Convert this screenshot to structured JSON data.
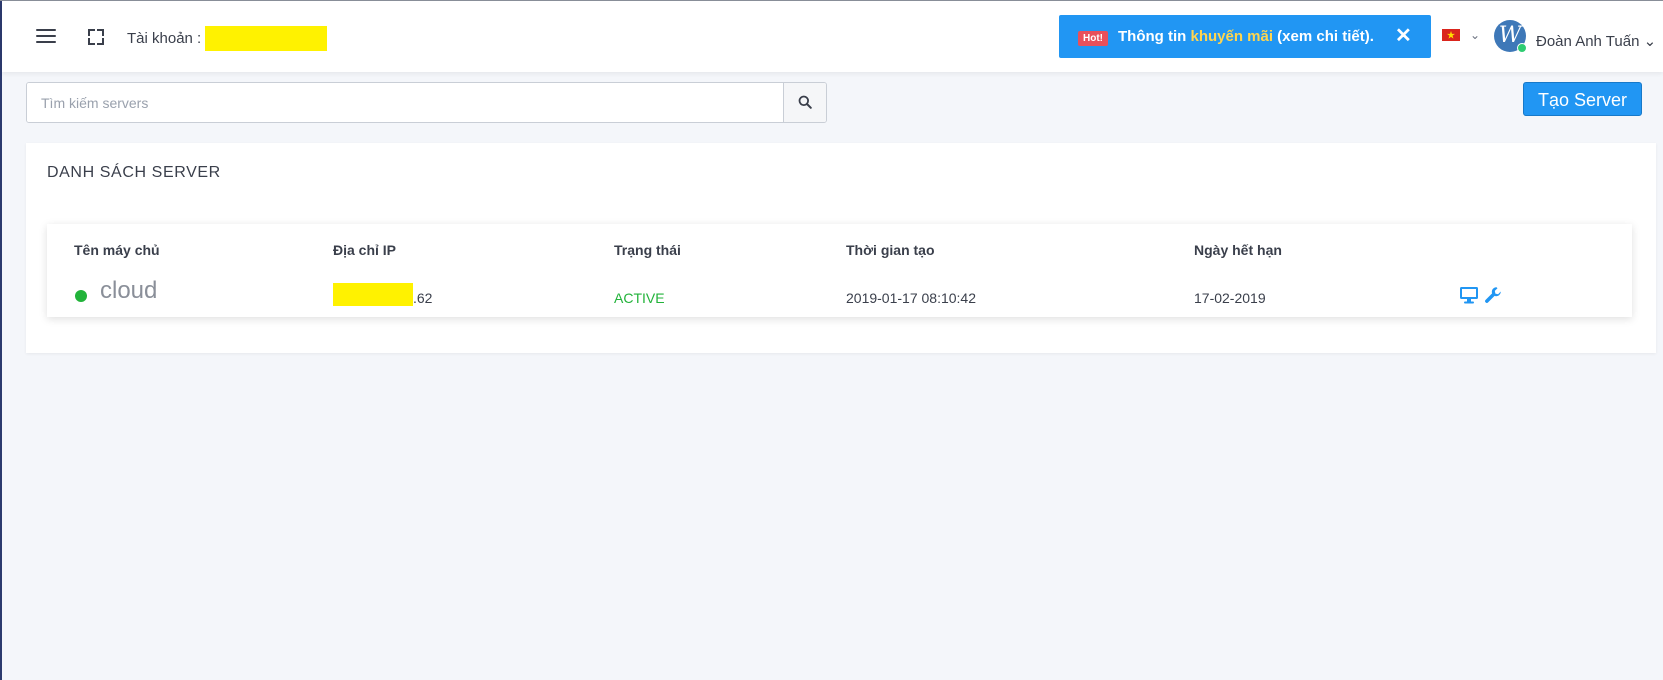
{
  "header": {
    "account_label": "Tài khoản :",
    "promo": {
      "badge": "Hot!",
      "text_before": "Thông tin ",
      "text_highlight": "khuyến mãi",
      "text_after": " (xem chi tiết).",
      "close": "✕"
    },
    "language_caret": "⌄",
    "avatar_letter": "W",
    "user_name": "Đoàn Anh Tuấn ⌄"
  },
  "search": {
    "placeholder": "Tìm kiếm servers"
  },
  "create_button": "Tạo Server",
  "server_list": {
    "title": "DANH SÁCH SERVER",
    "columns": [
      "Tên máy chủ",
      "Địa chỉ IP",
      "Trạng thái",
      "Thời gian tạo",
      "Ngày hết hạn"
    ],
    "rows": [
      {
        "name": "cloud",
        "ip_suffix": ".62",
        "status": "ACTIVE",
        "created": "2019-01-17 08:10:42",
        "expires": "17-02-2019"
      }
    ]
  },
  "colors": {
    "primary": "#2196f3",
    "active": "#22b33a",
    "redaction": "#fff200",
    "promo_highlight": "#ffd54f"
  },
  "icons": [
    "menu-icon",
    "fullscreen-icon",
    "close-icon",
    "vietnam-flag-icon",
    "search-icon",
    "status-dot-icon",
    "monitor-icon",
    "wrench-icon"
  ]
}
